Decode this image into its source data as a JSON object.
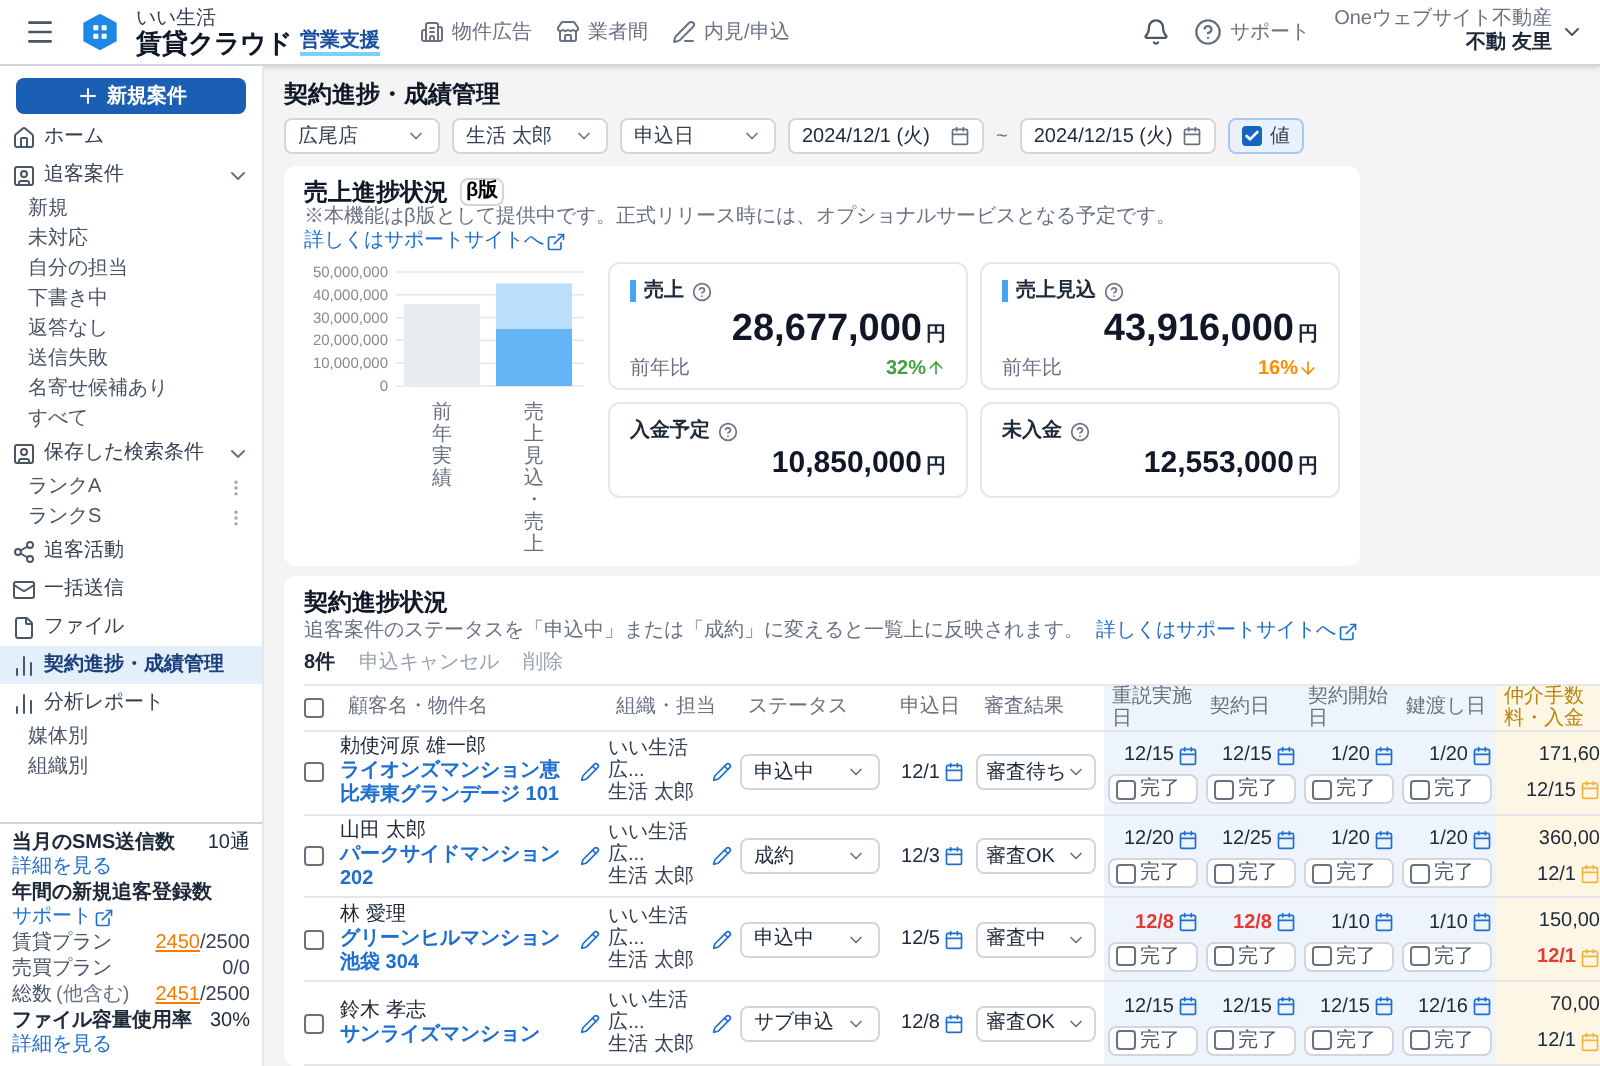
{
  "header": {
    "brand_small": "いい生活",
    "brand": "賃貸クラウド",
    "product": "営業支援",
    "nav": [
      {
        "label": "物件広告"
      },
      {
        "label": "業者間"
      },
      {
        "label": "内見/申込"
      }
    ],
    "support": "サポート",
    "account": {
      "company": "Oneウェブサイト不動産",
      "user": "不動 友里"
    }
  },
  "sidebar": {
    "new_button": "新規案件",
    "items": [
      {
        "label": "ホーム",
        "selected": false
      },
      {
        "label": "追客案件",
        "selected": false,
        "expanded": true,
        "children": [
          {
            "label": "新規",
            "selected": false
          },
          {
            "label": "未対応",
            "selected": false
          },
          {
            "label": "自分の担当",
            "selected": false
          },
          {
            "label": "下書き中",
            "selected": false
          },
          {
            "label": "返答なし",
            "selected": false
          },
          {
            "label": "送信失敗",
            "selected": false
          },
          {
            "label": "名寄せ候補あり",
            "selected": false
          },
          {
            "label": "すべて",
            "selected": false
          }
        ]
      },
      {
        "label": "保存した検索条件",
        "selected": false,
        "expanded": true,
        "children": [
          {
            "label": "ランクA",
            "selected": false,
            "menu": true
          },
          {
            "label": "ランクS",
            "selected": false,
            "menu": true
          }
        ]
      },
      {
        "label": "追客活動",
        "selected": false
      },
      {
        "label": "一括送信",
        "selected": false
      },
      {
        "label": "ファイル",
        "selected": false
      },
      {
        "label": "契約進捗・成績管理",
        "selected": true
      },
      {
        "label": "分析レポート",
        "selected": false,
        "children": [
          {
            "label": "媒体別",
            "selected": false
          },
          {
            "label": "組織別",
            "selected": false
          }
        ]
      }
    ],
    "stats": [
      {
        "kind": "heading",
        "label": "当月のSMS送信数",
        "link": "詳細を見る",
        "value": "10通"
      },
      {
        "kind": "heading",
        "label": "年間の新規追客登録数",
        "link": "サポート",
        "external": true
      },
      {
        "kind": "plan",
        "label": "賃貸プラン",
        "used": "2450",
        "total": "/2500"
      },
      {
        "kind": "plan",
        "label": "売買プラン",
        "total": "0/0"
      },
      {
        "kind": "plan",
        "label": "総数",
        "note": "(他含む)",
        "used": "2451",
        "total": "/2500"
      },
      {
        "kind": "heading",
        "label": "ファイル容量使用率",
        "link": "詳細を見る",
        "value": "30%"
      }
    ]
  },
  "page": {
    "title": "契約進捗・成績管理",
    "filters": [
      {
        "kind": "select",
        "value": "広尾店"
      },
      {
        "kind": "select",
        "value": "生活 太郎"
      },
      {
        "kind": "select",
        "value": "申込日"
      },
      {
        "kind": "date",
        "value": "2024/12/1 (火)"
      },
      {
        "kind": "separator",
        "text": "~"
      },
      {
        "kind": "date",
        "value": "2024/12/15 (火)"
      },
      {
        "kind": "checkbox",
        "label": "値",
        "checked": true
      }
    ]
  },
  "sales": {
    "title": "売上進捗状況",
    "badge": "β版",
    "note": "※本機能はβ版として提供中です。正式リリース時には、オプショナルサービスとなる予定です。",
    "link": "詳しくはサポートサイトへ",
    "chart_data": {
      "type": "bar",
      "stacked": true,
      "grid": true,
      "categories": [
        "前年実績",
        "売上見込・売上"
      ],
      "series": [
        {
          "color": "#e8ecf0",
          "values": [
            36000000,
            null
          ]
        },
        {
          "color": "#64b5f6",
          "values": [
            null,
            25000000
          ]
        },
        {
          "color": "#bbdefb",
          "values": [
            null,
            20000000
          ]
        }
      ],
      "ylim": [
        0,
        50000000
      ],
      "yticks": [
        {
          "value": 0,
          "label": "0"
        },
        {
          "value": 10000000,
          "label": "10,000,000"
        },
        {
          "value": 20000000,
          "label": "20,000,000"
        },
        {
          "value": 30000000,
          "label": "30,000,000"
        },
        {
          "value": 40000000,
          "label": "40,000,000"
        },
        {
          "value": 50000000,
          "label": "50,000,000"
        }
      ]
    },
    "kpis": [
      {
        "title": "売上",
        "accent": true,
        "value": "28,677,000",
        "unit": "円",
        "compare_label": "前年比",
        "change": "32%",
        "increase": true
      },
      {
        "title": "売上見込",
        "accent": true,
        "value": "43,916,000",
        "unit": "円",
        "compare_label": "前年比",
        "change": "16%",
        "increase": false
      },
      {
        "title": "入金予定",
        "accent": false,
        "value": "10,850,000",
        "unit": "円"
      },
      {
        "title": "未入金",
        "accent": false,
        "value": "12,553,000",
        "unit": "円"
      }
    ]
  },
  "contracts": {
    "title": "契約進捗状況",
    "description": "追客案件のステータスを「申込中」または「成約」に変えると一覧上に反映されます。",
    "link": "詳しくはサポートサイトへ",
    "count": "8件",
    "actions": [
      {
        "label": "申込キャンセル",
        "disabled": true
      },
      {
        "label": "削除",
        "disabled": true
      }
    ],
    "all_selected": false,
    "columns": [
      "顧客名・物件名",
      "組織・担当",
      "ステータス",
      "申込日",
      "審査結果",
      "重説実施日",
      "契約日",
      "契約開始日",
      "鍵渡し日",
      "仲介手数料・入金"
    ],
    "rows": [
      {
        "selected": false,
        "customer": "勅使河原 雄一郎",
        "property": "ライオンズマンション恵比寿東グランデージ 101",
        "org": "いい生活広...",
        "staff": "生活 太郎",
        "status": "申込中",
        "applied": "12/1",
        "screening": "審査待ち",
        "milestones": [
          {
            "date": "12/15",
            "overdue": false,
            "done": false,
            "label": "完了"
          },
          {
            "date": "12/15",
            "overdue": false,
            "done": false,
            "label": "完了"
          },
          {
            "date": "1/20",
            "overdue": false,
            "done": false,
            "label": "完了"
          },
          {
            "date": "1/20",
            "overdue": false,
            "done": false,
            "label": "完了"
          }
        ],
        "fee": "171,60",
        "payment": {
          "date": "12/15",
          "overdue": false
        }
      },
      {
        "selected": false,
        "customer": "山田 太郎",
        "property": "パークサイドマンション 202",
        "org": "いい生活広...",
        "staff": "生活 太郎",
        "status": "成約",
        "applied": "12/3",
        "screening": "審査OK",
        "milestones": [
          {
            "date": "12/20",
            "overdue": false,
            "done": false,
            "label": "完了"
          },
          {
            "date": "12/25",
            "overdue": false,
            "done": false,
            "label": "完了"
          },
          {
            "date": "1/20",
            "overdue": false,
            "done": false,
            "label": "完了"
          },
          {
            "date": "1/20",
            "overdue": false,
            "done": false,
            "label": "完了"
          }
        ],
        "fee": "360,00",
        "payment": {
          "date": "12/1",
          "overdue": false
        }
      },
      {
        "selected": false,
        "customer": "林 愛理",
        "property": "グリーンヒルマンション池袋 304",
        "org": "いい生活広...",
        "staff": "生活 太郎",
        "status": "申込中",
        "applied": "12/5",
        "screening": "審査中",
        "milestones": [
          {
            "date": "12/8",
            "overdue": true,
            "done": false,
            "label": "完了"
          },
          {
            "date": "12/8",
            "overdue": true,
            "done": false,
            "label": "完了"
          },
          {
            "date": "1/10",
            "overdue": false,
            "done": false,
            "label": "完了"
          },
          {
            "date": "1/10",
            "overdue": false,
            "done": false,
            "label": "完了"
          }
        ],
        "fee": "150,00",
        "payment": {
          "date": "12/1",
          "overdue": true
        }
      },
      {
        "selected": false,
        "customer": "鈴木 孝志",
        "property": "サンライズマンション",
        "org": "いい生活広...",
        "staff": "生活 太郎",
        "status": "サブ申込",
        "applied": "12/8",
        "screening": "審査OK",
        "milestones": [
          {
            "date": "12/15",
            "overdue": false,
            "done": false,
            "label": "完了"
          },
          {
            "date": "12/15",
            "overdue": false,
            "done": false,
            "label": "完了"
          },
          {
            "date": "12/15",
            "overdue": false,
            "done": false,
            "label": "完了"
          },
          {
            "date": "12/16",
            "overdue": false,
            "done": false,
            "label": "完了"
          }
        ],
        "fee": "70,00",
        "payment": {
          "date": "12/1",
          "overdue": false
        }
      }
    ]
  }
}
